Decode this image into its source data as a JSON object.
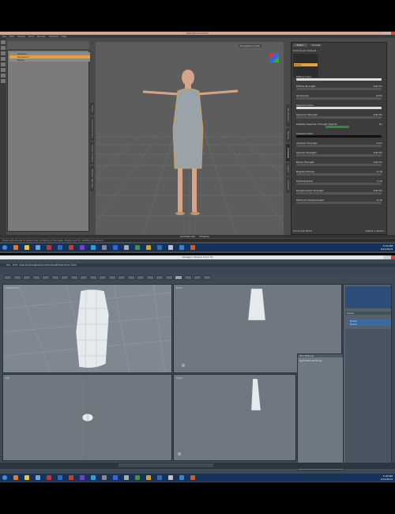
{
  "daz": {
    "title": "DAZ Studio 4.6 Pro",
    "menu": [
      "File",
      "Edit",
      "Create",
      "Tools",
      "Render",
      "Window",
      "Help"
    ],
    "scene_items": [
      "Genesis",
      "Genesis 2",
      "Dress"
    ],
    "viewport_camera": "Perspective View",
    "left_tabs": [
      "Scene",
      "Content Library",
      "Smart Content",
      "Render Settings"
    ],
    "right_tabs": [
      "Parameters",
      "Posing",
      "Surfaces",
      "Lights",
      "Cameras"
    ],
    "surfaces_tabs": [
      "Editor",
      "Presets"
    ],
    "shader_label": "DAZ Studio Default",
    "surface_selected": "Dress",
    "properties": [
      {
        "label": "Diffuse Color",
        "value": ""
      },
      {
        "label": "Diffuse Strength",
        "value": "100.0%"
      },
      {
        "label": "Glossiness",
        "value": "8.0%"
      },
      {
        "label": "Specular Color",
        "value": ""
      },
      {
        "label": "Specular Strength",
        "value": "100.0%"
      },
      {
        "label": "Multiply Specular Through Opacity",
        "value": "On"
      },
      {
        "label": "Ambient Color",
        "value": ""
      },
      {
        "label": "Ambient Strength",
        "value": "0.0%"
      },
      {
        "label": "Opacity Strength",
        "value": "100.0%"
      },
      {
        "label": "Bump Strength",
        "value": "100.0%"
      },
      {
        "label": "Negative Bump",
        "value": "-0.10"
      },
      {
        "label": "Positive Bump",
        "value": "0.10"
      },
      {
        "label": "Displacement Strength",
        "value": "100.0%"
      },
      {
        "label": "Minimum Displacement",
        "value": "-0.10"
      }
    ],
    "show_sub_items": "Show Sub Items",
    "status_text": "Select a Lesson...",
    "status_tabs": [
      "Animate Lite",
      "Timeline"
    ],
    "bottom_hint": "Press Left-Mouse to select the contents of the page. Right-click for additional options."
  },
  "hexagon": {
    "title": "Hexagon Version 2.5.1.79",
    "menu": [
      "File",
      "Edit",
      "View",
      "Drawing",
      "Selection",
      "Windows",
      "Extras",
      "Tools",
      "Help"
    ],
    "viewports": [
      "Perspective",
      "Front",
      "Top",
      "Right"
    ],
    "scene_tree_title": "Scene",
    "scene_tree_items": [
      "Dress",
      "Dress"
    ],
    "floating_panel_title": "Tool Options",
    "floating_panel_item": "Symmetrical Faces"
  },
  "taskbar": {
    "clock_top": "5:29 PM",
    "clock_bottom": "3/11/2014"
  }
}
